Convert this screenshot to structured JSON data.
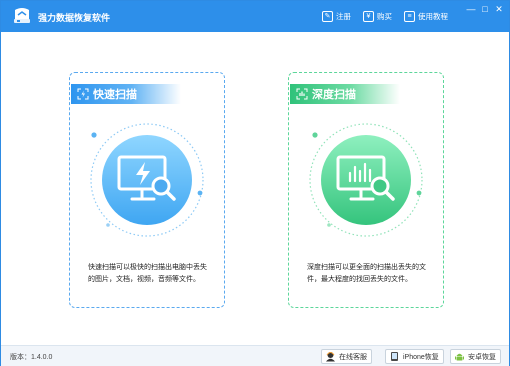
{
  "titlebar": {
    "title": "强力数据恢复软件",
    "links": [
      {
        "label": "注册",
        "icon": "register-icon"
      },
      {
        "label": "购买",
        "icon": "buy-icon"
      },
      {
        "label": "使用教程",
        "icon": "tutorial-icon"
      }
    ],
    "window_buttons": [
      "minimize-icon",
      "maximize-icon",
      "close-icon"
    ]
  },
  "cards": {
    "quick": {
      "title": "快速扫描",
      "description": "快速扫描可以极快的扫描出电脑中丢失的图片，文档，视频，音频等文件。",
      "accent": "#2e95ef",
      "icon": "monitor-lightning-search-icon"
    },
    "deep": {
      "title": "深度扫描",
      "description": "深度扫描可以更全面的扫描出丢失的文件，最大程度的找回丢失的文件。",
      "accent": "#2fc27a",
      "icon": "monitor-chart-search-icon"
    }
  },
  "footer": {
    "version": "版本：1.4.0.0",
    "buttons": [
      {
        "label": "在线客服",
        "icon": "customer-service-icon"
      },
      {
        "label": "iPhone恢复",
        "icon": "iphone-icon"
      },
      {
        "label": "安卓恢复",
        "icon": "android-icon"
      }
    ]
  }
}
